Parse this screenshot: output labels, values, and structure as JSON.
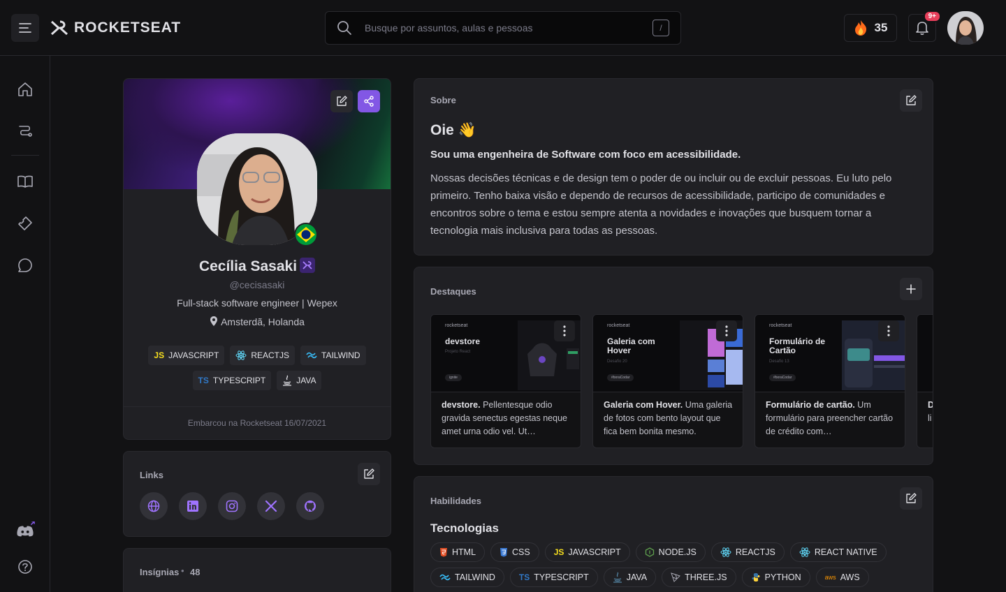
{
  "header": {
    "logo_text": "ROCKETSEAT",
    "search_placeholder": "Busque por assuntos, aulas e pessoas",
    "search_shortcut": "/",
    "streak_count": "35",
    "notification_badge": "9+"
  },
  "profile": {
    "name": "Cecília Sasaki",
    "handle": "@cecisasaki",
    "role": "Full-stack software engineer | Wepex",
    "location": "Amsterdã, Holanda",
    "tags_row1": [
      "JAVASCRIPT",
      "REACTJS",
      "TAILWIND"
    ],
    "tags_row2": [
      "TYPESCRIPT",
      "JAVA"
    ],
    "tag_prefix_js": "JS",
    "tag_prefix_ts": "TS",
    "joined": "Embarcou na Rocketseat 16/07/2021"
  },
  "links": {
    "label": "Links"
  },
  "badges": {
    "label": "Insígnias",
    "count": "48"
  },
  "about": {
    "label": "Sobre",
    "title": "Oie 👋",
    "subtitle": "Sou uma engenheira de Software com foco em acessibilidade.",
    "body": "Nossas decisões técnicas e de design tem o poder de ou incluir ou de excluir pessoas. Eu luto pelo primeiro. Tenho baixa visão e dependo de recursos de acessibilidade, participo de comunidades e encontros sobre o tema e estou sempre atenta a novidades e inovações que busquem tornar a tecnologia mais inclusiva para todas as pessoas."
  },
  "highlights": {
    "label": "Destaques",
    "items": [
      {
        "brand": "rocketseat",
        "thumb_title": "devstore",
        "thumb_sub": "Projeto React",
        "pill": "ignite",
        "title": "devstore.",
        "desc": " Pellentesque odio gravida senectus egestas neque amet urna odio vel. Ut…"
      },
      {
        "brand": "rocketseat",
        "thumb_title": "Galeria com Hover",
        "thumb_sub": "Desafio 20",
        "pill": "#boraCodar",
        "title": "Galeria com Hover.",
        "desc": " Uma galeria de fotos com bento layout que fica bem bonita mesmo."
      },
      {
        "brand": "rocketseat",
        "thumb_title": "Formulário de Cartão",
        "thumb_sub": "Desafio 13",
        "pill": "#boraCodar",
        "title": "Formulário de cartão.",
        "desc": " Um formulário para preencher cartão de crédito com…"
      },
      {
        "title": "D",
        "desc": "li"
      }
    ]
  },
  "skills": {
    "label": "Habilidades",
    "title": "Tecnologias",
    "row1": [
      "HTML",
      "CSS",
      "JAVASCRIPT",
      "NODE.JS",
      "REACTJS",
      "REACT NATIVE"
    ],
    "row2": [
      "TAILWIND",
      "TYPESCRIPT",
      "JAVA",
      "THREE.JS",
      "PYTHON",
      "AWS"
    ],
    "prefix_js": "JS",
    "prefix_ts": "TS",
    "prefix_aws": "aws"
  },
  "colors": {
    "accent": "#8257e5",
    "background": "#121214",
    "surface": "#202024",
    "border": "#29292e",
    "badge": "#e83f5b"
  }
}
